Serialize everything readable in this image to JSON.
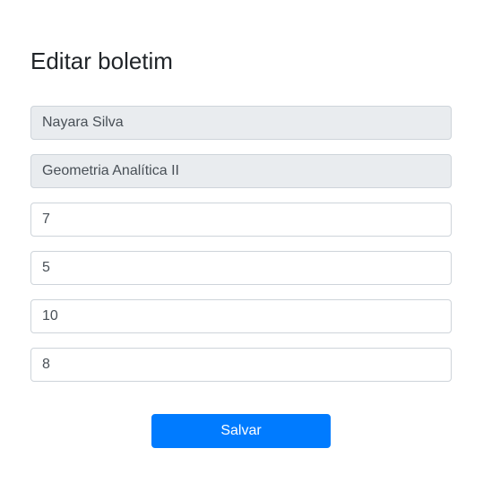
{
  "form": {
    "title": "Editar boletim",
    "student_name": "Nayara Silva",
    "subject": "Geometria Analítica II",
    "grades": [
      "7",
      "5",
      "10",
      "8"
    ],
    "save_label": "Salvar"
  },
  "colors": {
    "primary": "#007bff",
    "readonly_bg": "#e9ecef",
    "border": "#ced4da"
  }
}
